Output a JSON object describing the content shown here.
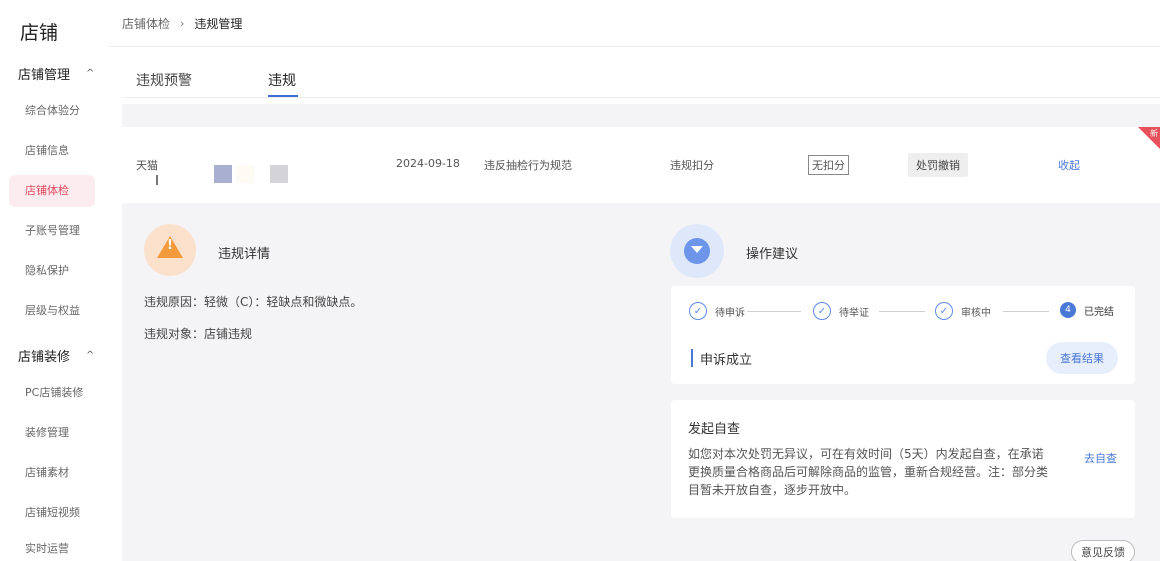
{
  "sidebar": {
    "brand": "店铺",
    "group_shop_manage": "店铺管理",
    "group_shop_decor": "店铺装修",
    "items_manage": [
      {
        "label": "综合体验分"
      },
      {
        "label": "店铺信息"
      },
      {
        "label": "店铺体检"
      },
      {
        "label": "子账号管理"
      },
      {
        "label": "隐私保护"
      },
      {
        "label": "层级与权益"
      }
    ],
    "items_decor": [
      {
        "label": "PC店铺装修"
      },
      {
        "label": "装修管理"
      },
      {
        "label": "店铺素材"
      },
      {
        "label": "店铺短视频"
      },
      {
        "label": "实时运营"
      }
    ],
    "chevron": "^"
  },
  "breadcrumb": {
    "parent": "店铺体检",
    "separator": "›",
    "current": "违规管理"
  },
  "tabs": [
    {
      "label": "违规预警"
    },
    {
      "label": "违规"
    }
  ],
  "violation_row": {
    "platform": "天猫",
    "date": "2024-09-18",
    "rule": "违反抽检行为规范",
    "deduction_type": "违规扣分",
    "deduction_value": "无扣分",
    "status": "处罚撤销",
    "collapse_label": "收起",
    "new_badge": "新",
    "colors": {
      "swatch1": "#a9b0cf",
      "swatch2": "#d3d3d8"
    }
  },
  "detail": {
    "title": "违规详情",
    "reason_label": "违规原因：",
    "reason_value": "轻微（C）：轻缺点和微缺点。",
    "target_label": "违规对象：",
    "target_value": "店铺违规",
    "icon": "warning-icon"
  },
  "suggestion": {
    "title": "操作建议",
    "icon": "funnel-icon",
    "steps": [
      {
        "label": "待申诉",
        "state": "done"
      },
      {
        "label": "待举证",
        "state": "done"
      },
      {
        "label": "审核中",
        "state": "done"
      },
      {
        "label": "已完结",
        "state": "current",
        "number": "4"
      }
    ],
    "appeal_result": "申诉成立",
    "view_result_label": "查看结果",
    "self_check_title": "发起自查",
    "self_check_text": "如您对本次处罚无异议，可在有效时间（5天）内发起自查，在承诺更换质量合格商品后可解除商品的监管，重新合规经营。注：部分类目暂未开放自查，逐步开放中。",
    "self_check_link": "去自查",
    "feedback_label": "意见反馈"
  },
  "colors": {
    "accent": "#4a78d6",
    "active_nav_bg": "#fdecef",
    "active_nav_text": "#e04a5f",
    "warning": "#f29a3c"
  }
}
